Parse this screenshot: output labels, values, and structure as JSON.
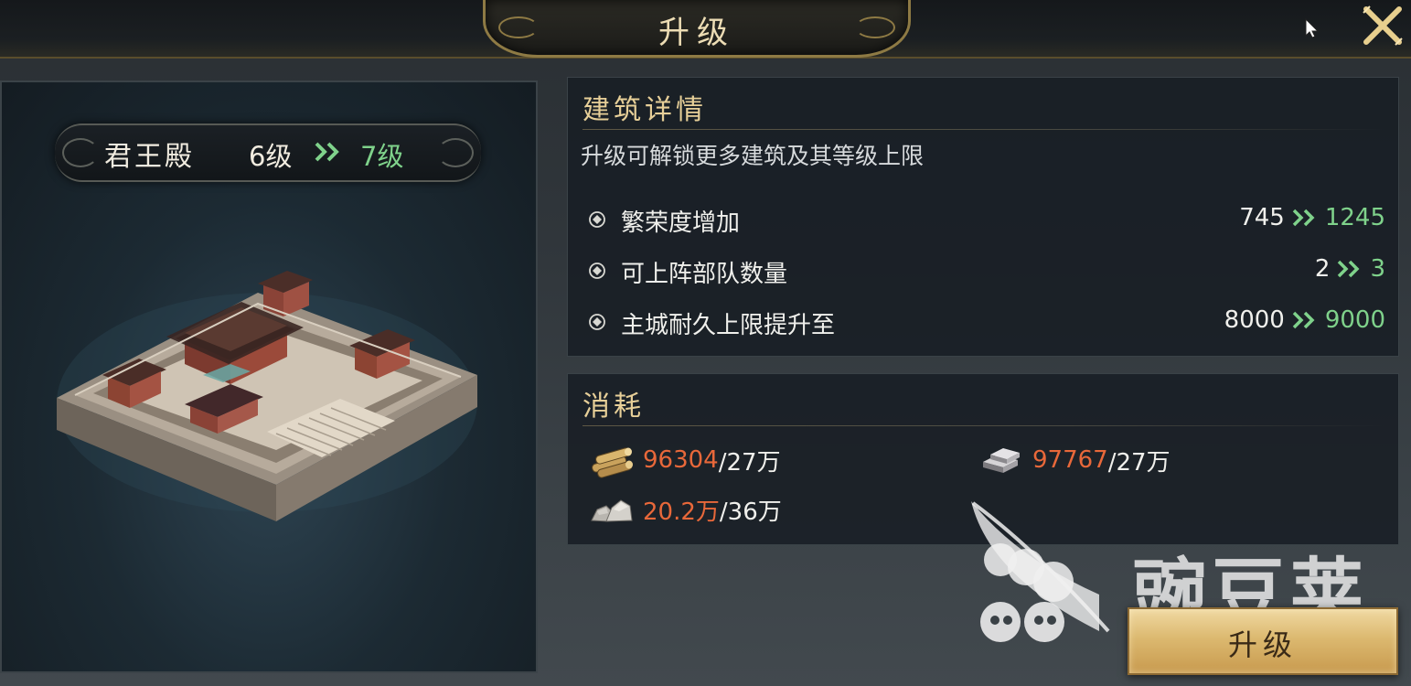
{
  "header": {
    "title": "升级"
  },
  "building": {
    "name": "君王殿",
    "current_level": "6级",
    "next_level": "7级"
  },
  "details": {
    "title": "建筑详情",
    "description": "升级可解锁更多建筑及其等级上限",
    "stats": [
      {
        "label": "繁荣度增加",
        "from": "745",
        "to": "1245"
      },
      {
        "label": "可上阵部队数量",
        "from": "2",
        "to": "3"
      },
      {
        "label": "主城耐久上限提升至",
        "from": "8000",
        "to": "9000"
      }
    ]
  },
  "cost": {
    "title": "消耗",
    "resources": [
      {
        "icon": "wood-icon",
        "have": "96304",
        "need": "/27万"
      },
      {
        "icon": "iron-icon",
        "have": "97767",
        "need": "/27万"
      },
      {
        "icon": "stone-icon",
        "have": "20.2万",
        "need": "/36万"
      }
    ]
  },
  "actions": {
    "upgrade_label": "升级"
  },
  "watermark": {
    "text": "豌豆荚"
  },
  "colors": {
    "accent_gold": "#e7cf98",
    "level_up_green": "#7fd28b",
    "insufficient_orange": "#e8683a",
    "button_gold": "#dcb970"
  }
}
